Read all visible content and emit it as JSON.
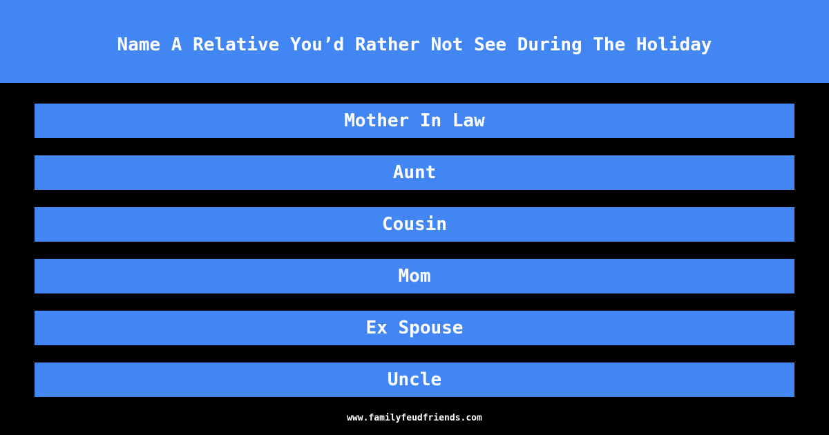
{
  "question": "Name A Relative You’d Rather Not See During The Holiday",
  "answers": [
    "Mother In Law",
    "Aunt",
    "Cousin",
    "Mom",
    "Ex Spouse",
    "Uncle"
  ],
  "footer": "www.familyfeudfriends.com",
  "colors": {
    "accent": "#4286f4",
    "background": "#000000",
    "text": "#ffffff"
  }
}
